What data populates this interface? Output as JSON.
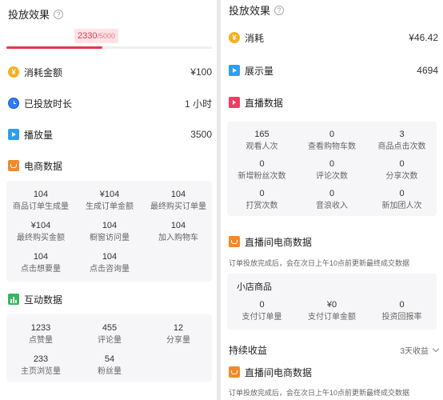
{
  "left": {
    "title": "投放效果",
    "progress": {
      "current": "2330",
      "max": "/5000",
      "fraction": 0.466
    },
    "metrics": [
      {
        "label": "消耗金额",
        "value": "¥100",
        "icon": "coin-icon"
      },
      {
        "label": "已投放时长",
        "value": "1 小时",
        "icon": "alarm-clock-icon"
      },
      {
        "label": "播放量",
        "value": "3500",
        "icon": "play-icon"
      }
    ],
    "ecommerce": {
      "title": "电商数据",
      "items": [
        {
          "value": "104",
          "label": "商品订单生成量"
        },
        {
          "value": "¥104",
          "label": "生成订单金额"
        },
        {
          "value": "104",
          "label": "最终购买订单量"
        },
        {
          "value": "¥104",
          "label": "最终购买金额"
        },
        {
          "value": "104",
          "label": "橱窗访问量"
        },
        {
          "value": "104",
          "label": "加入购物车"
        },
        {
          "value": "104",
          "label": "点击想要量"
        },
        {
          "value": "104",
          "label": "点击咨询量"
        }
      ]
    },
    "interaction": {
      "title": "互动数据",
      "items": [
        {
          "value": "1233",
          "label": "点赞量"
        },
        {
          "value": "455",
          "label": "评论量"
        },
        {
          "value": "12",
          "label": "分享量"
        },
        {
          "value": "233",
          "label": "主页浏览量"
        },
        {
          "value": "54",
          "label": "粉丝量"
        }
      ]
    }
  },
  "right": {
    "title": "投放效果",
    "metrics": [
      {
        "label": "消耗",
        "value": "¥46.42",
        "icon": "coin-icon"
      },
      {
        "label": "展示量",
        "value": "4694",
        "icon": "play-icon"
      }
    ],
    "live": {
      "title": "直播数据",
      "items": [
        {
          "value": "165",
          "label": "观看人次"
        },
        {
          "value": "0",
          "label": "查看购物车数"
        },
        {
          "value": "3",
          "label": "商品点击次数"
        },
        {
          "value": "0",
          "label": "新增粉丝次数"
        },
        {
          "value": "0",
          "label": "评论次数"
        },
        {
          "value": "0",
          "label": "分享次数"
        },
        {
          "value": "0",
          "label": "打赏次数"
        },
        {
          "value": "0",
          "label": "音浪收入"
        },
        {
          "value": "0",
          "label": "新加团人次"
        }
      ]
    },
    "live_ecom": {
      "title": "直播间电商数据",
      "note": "订单投放完成后，会在次日上午10点前更新最终成交数据",
      "subtitle": "小店商品",
      "items": [
        {
          "value": "0",
          "label": "支付订单量"
        },
        {
          "value": "¥0",
          "label": "支付订单金额"
        },
        {
          "value": "0",
          "label": "投资回报率"
        }
      ]
    },
    "sustained": {
      "title": "持续收益",
      "period": "3天收益"
    },
    "live_ecom2": {
      "title": "直播间电商数据",
      "note": "订单投放完成后，会在次日上午10点前更新最终成交数据"
    }
  }
}
